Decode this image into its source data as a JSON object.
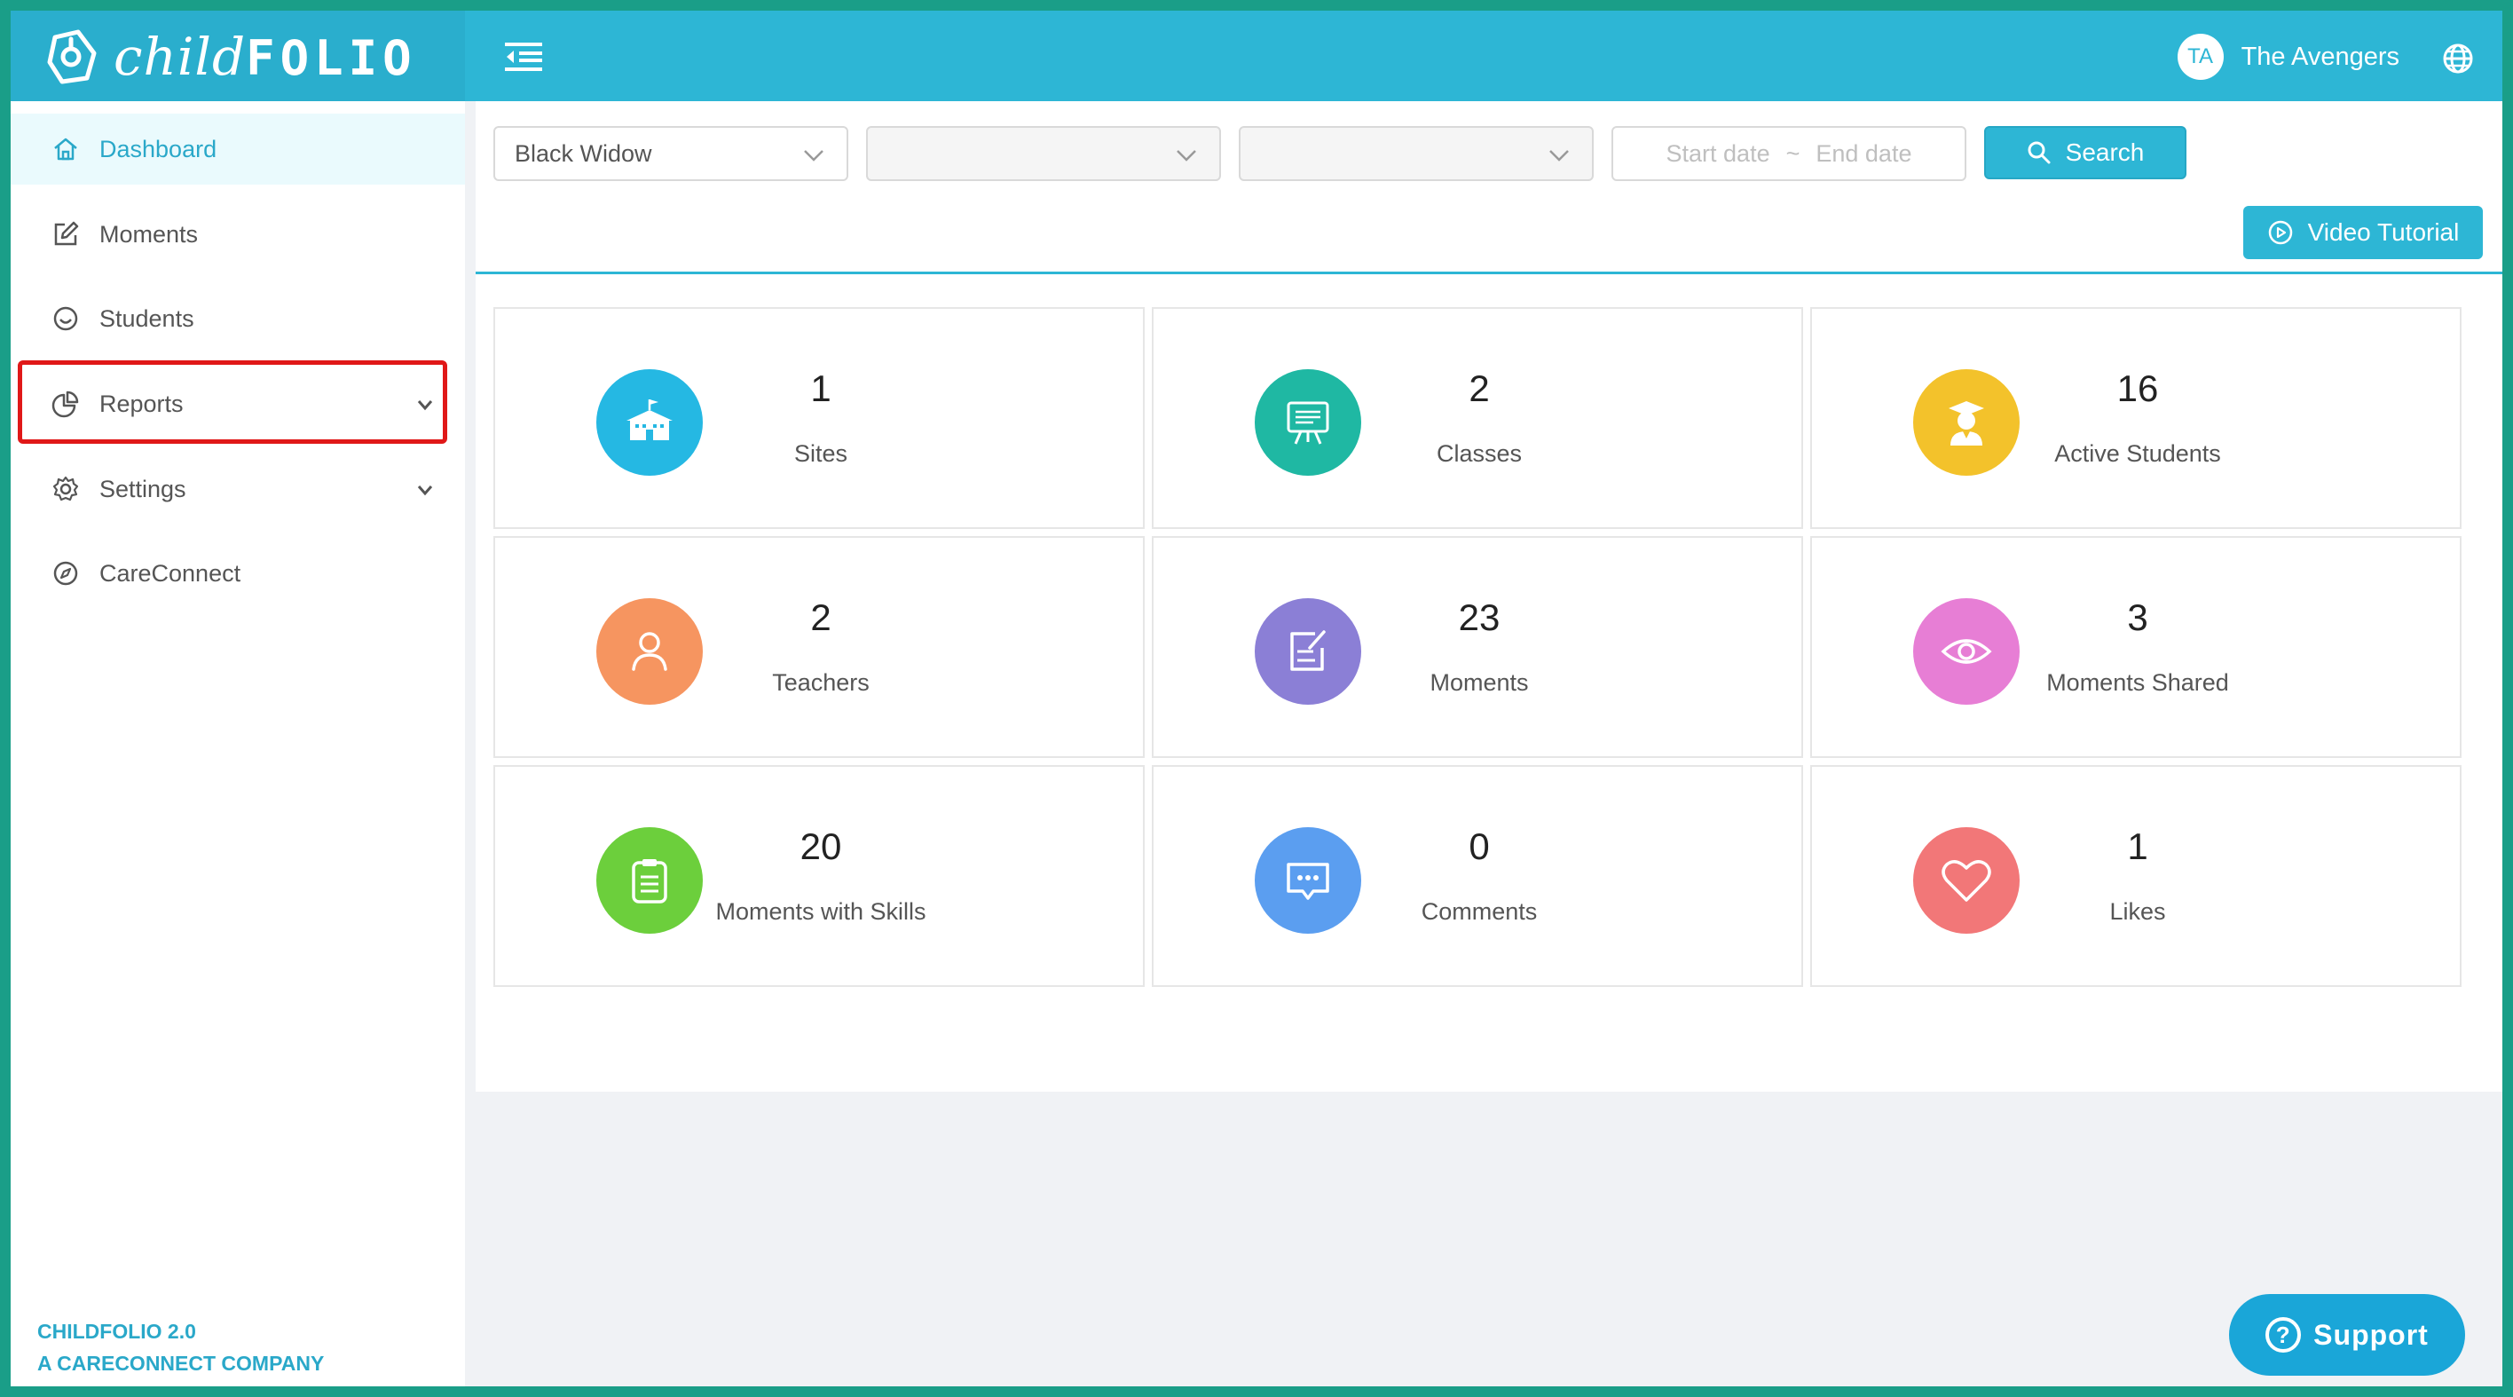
{
  "app": {
    "logo_text": "childFOLIO",
    "user_initials": "TA",
    "user_name": "The Avengers"
  },
  "sidebar": {
    "items": [
      {
        "label": "Dashboard",
        "icon": "home-icon",
        "active": true
      },
      {
        "label": "Moments",
        "icon": "edit-icon"
      },
      {
        "label": "Students",
        "icon": "smile-icon"
      },
      {
        "label": "Reports",
        "icon": "pie-chart-icon",
        "expandable": true
      },
      {
        "label": "Settings",
        "icon": "gear-icon",
        "expandable": true
      },
      {
        "label": "CareConnect",
        "icon": "compass-icon"
      }
    ],
    "footer_line1": "CHILDFOLIO 2.0",
    "footer_line2": "A CARECONNECT COMPANY"
  },
  "filters": {
    "site_value": "Black Widow",
    "class_value": "",
    "student_value": "",
    "start_placeholder": "Start date",
    "separator": "~",
    "end_placeholder": "End date",
    "search_label": "Search"
  },
  "video_tutorial_label": "Video Tutorial",
  "stats": [
    {
      "value": "1",
      "label": "Sites",
      "color": "#25b8e3",
      "icon": "school-icon"
    },
    {
      "value": "2",
      "label": "Classes",
      "color": "#1fb8a3",
      "icon": "presentation-board-icon"
    },
    {
      "value": "16",
      "label": "Active Students",
      "color": "#f3c22b",
      "icon": "graduate-icon"
    },
    {
      "value": "2",
      "label": "Teachers",
      "color": "#f69560",
      "icon": "user-icon"
    },
    {
      "value": "23",
      "label": "Moments",
      "color": "#8b7fd6",
      "icon": "note-edit-icon"
    },
    {
      "value": "3",
      "label": "Moments Shared",
      "color": "#e77ed5",
      "icon": "eye-icon"
    },
    {
      "value": "20",
      "label": "Moments with Skills",
      "color": "#6ccf3c",
      "icon": "clipboard-list-icon"
    },
    {
      "value": "0",
      "label": "Comments",
      "color": "#5b9ef0",
      "icon": "chat-bubble-icon"
    },
    {
      "value": "1",
      "label": "Likes",
      "color": "#f27778",
      "icon": "heart-icon"
    }
  ],
  "support_label": "Support"
}
